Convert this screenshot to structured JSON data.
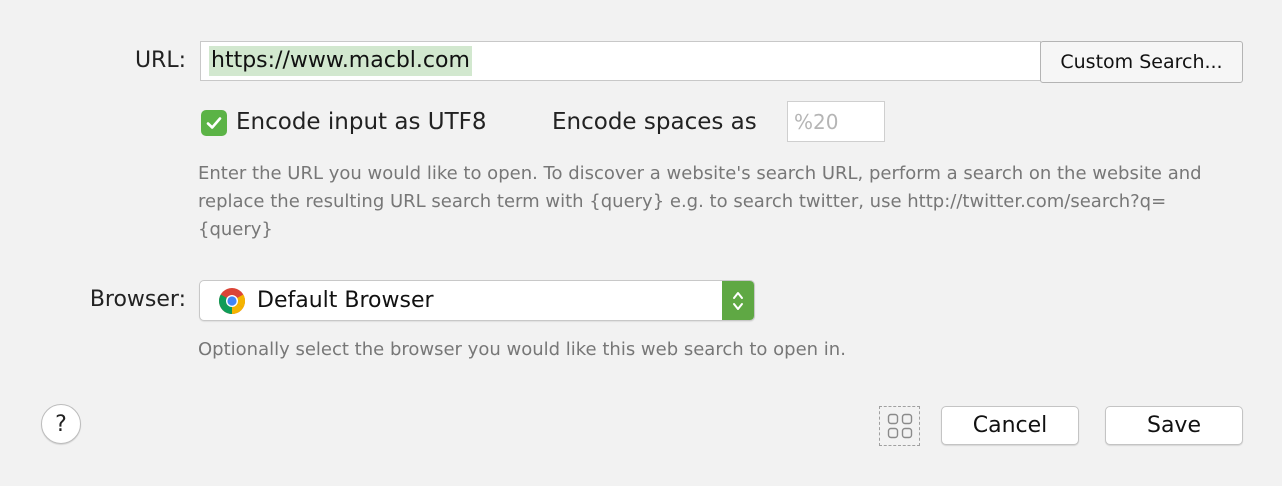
{
  "url_row": {
    "label": "URL:",
    "value": "https://www.macbl.com",
    "custom_search_label": "Custom Search..."
  },
  "encode_row": {
    "utf8_label": "Encode input as UTF8",
    "utf8_checked": true,
    "spaces_label": "Encode spaces as",
    "spaces_placeholder": "%20"
  },
  "url_help": "Enter the URL you would like to open. To discover a website's search URL, perform a search on the website and replace the resulting URL search term with {query} e.g. to search twitter, use http://twitter.com/search?q={query}",
  "browser_row": {
    "label": "Browser:",
    "selected": "Default Browser",
    "icon": "chrome-icon",
    "help": "Optionally select the browser you would like this web search to open in."
  },
  "footer": {
    "help_glyph": "?",
    "cancel_label": "Cancel",
    "save_label": "Save"
  },
  "colors": {
    "accent": "#5fa844",
    "checkbox": "#5bb346",
    "selection_highlight": "#d2e8cf",
    "background": "#f2f2f2"
  }
}
